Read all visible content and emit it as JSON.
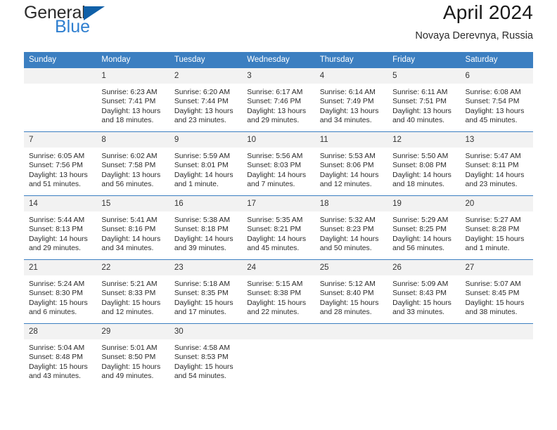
{
  "brand": {
    "line1": "General",
    "line2": "Blue",
    "logo_icon": "blue-triangle-icon"
  },
  "header": {
    "title": "April 2024",
    "subtitle": "Novaya Derevnya, Russia"
  },
  "calendar": {
    "weekday_headers": [
      "Sunday",
      "Monday",
      "Tuesday",
      "Wednesday",
      "Thursday",
      "Friday",
      "Saturday"
    ],
    "accent_color": "#3c7fc1",
    "daynum_bg": "#f2f2f2",
    "weeks": [
      [
        {
          "day": "",
          "sunrise": "",
          "sunset": "",
          "daylight_1": "",
          "daylight_2": ""
        },
        {
          "day": "1",
          "sunrise": "Sunrise: 6:23 AM",
          "sunset": "Sunset: 7:41 PM",
          "daylight_1": "Daylight: 13 hours",
          "daylight_2": "and 18 minutes."
        },
        {
          "day": "2",
          "sunrise": "Sunrise: 6:20 AM",
          "sunset": "Sunset: 7:44 PM",
          "daylight_1": "Daylight: 13 hours",
          "daylight_2": "and 23 minutes."
        },
        {
          "day": "3",
          "sunrise": "Sunrise: 6:17 AM",
          "sunset": "Sunset: 7:46 PM",
          "daylight_1": "Daylight: 13 hours",
          "daylight_2": "and 29 minutes."
        },
        {
          "day": "4",
          "sunrise": "Sunrise: 6:14 AM",
          "sunset": "Sunset: 7:49 PM",
          "daylight_1": "Daylight: 13 hours",
          "daylight_2": "and 34 minutes."
        },
        {
          "day": "5",
          "sunrise": "Sunrise: 6:11 AM",
          "sunset": "Sunset: 7:51 PM",
          "daylight_1": "Daylight: 13 hours",
          "daylight_2": "and 40 minutes."
        },
        {
          "day": "6",
          "sunrise": "Sunrise: 6:08 AM",
          "sunset": "Sunset: 7:54 PM",
          "daylight_1": "Daylight: 13 hours",
          "daylight_2": "and 45 minutes."
        }
      ],
      [
        {
          "day": "7",
          "sunrise": "Sunrise: 6:05 AM",
          "sunset": "Sunset: 7:56 PM",
          "daylight_1": "Daylight: 13 hours",
          "daylight_2": "and 51 minutes."
        },
        {
          "day": "8",
          "sunrise": "Sunrise: 6:02 AM",
          "sunset": "Sunset: 7:58 PM",
          "daylight_1": "Daylight: 13 hours",
          "daylight_2": "and 56 minutes."
        },
        {
          "day": "9",
          "sunrise": "Sunrise: 5:59 AM",
          "sunset": "Sunset: 8:01 PM",
          "daylight_1": "Daylight: 14 hours",
          "daylight_2": "and 1 minute."
        },
        {
          "day": "10",
          "sunrise": "Sunrise: 5:56 AM",
          "sunset": "Sunset: 8:03 PM",
          "daylight_1": "Daylight: 14 hours",
          "daylight_2": "and 7 minutes."
        },
        {
          "day": "11",
          "sunrise": "Sunrise: 5:53 AM",
          "sunset": "Sunset: 8:06 PM",
          "daylight_1": "Daylight: 14 hours",
          "daylight_2": "and 12 minutes."
        },
        {
          "day": "12",
          "sunrise": "Sunrise: 5:50 AM",
          "sunset": "Sunset: 8:08 PM",
          "daylight_1": "Daylight: 14 hours",
          "daylight_2": "and 18 minutes."
        },
        {
          "day": "13",
          "sunrise": "Sunrise: 5:47 AM",
          "sunset": "Sunset: 8:11 PM",
          "daylight_1": "Daylight: 14 hours",
          "daylight_2": "and 23 minutes."
        }
      ],
      [
        {
          "day": "14",
          "sunrise": "Sunrise: 5:44 AM",
          "sunset": "Sunset: 8:13 PM",
          "daylight_1": "Daylight: 14 hours",
          "daylight_2": "and 29 minutes."
        },
        {
          "day": "15",
          "sunrise": "Sunrise: 5:41 AM",
          "sunset": "Sunset: 8:16 PM",
          "daylight_1": "Daylight: 14 hours",
          "daylight_2": "and 34 minutes."
        },
        {
          "day": "16",
          "sunrise": "Sunrise: 5:38 AM",
          "sunset": "Sunset: 8:18 PM",
          "daylight_1": "Daylight: 14 hours",
          "daylight_2": "and 39 minutes."
        },
        {
          "day": "17",
          "sunrise": "Sunrise: 5:35 AM",
          "sunset": "Sunset: 8:21 PM",
          "daylight_1": "Daylight: 14 hours",
          "daylight_2": "and 45 minutes."
        },
        {
          "day": "18",
          "sunrise": "Sunrise: 5:32 AM",
          "sunset": "Sunset: 8:23 PM",
          "daylight_1": "Daylight: 14 hours",
          "daylight_2": "and 50 minutes."
        },
        {
          "day": "19",
          "sunrise": "Sunrise: 5:29 AM",
          "sunset": "Sunset: 8:25 PM",
          "daylight_1": "Daylight: 14 hours",
          "daylight_2": "and 56 minutes."
        },
        {
          "day": "20",
          "sunrise": "Sunrise: 5:27 AM",
          "sunset": "Sunset: 8:28 PM",
          "daylight_1": "Daylight: 15 hours",
          "daylight_2": "and 1 minute."
        }
      ],
      [
        {
          "day": "21",
          "sunrise": "Sunrise: 5:24 AM",
          "sunset": "Sunset: 8:30 PM",
          "daylight_1": "Daylight: 15 hours",
          "daylight_2": "and 6 minutes."
        },
        {
          "day": "22",
          "sunrise": "Sunrise: 5:21 AM",
          "sunset": "Sunset: 8:33 PM",
          "daylight_1": "Daylight: 15 hours",
          "daylight_2": "and 12 minutes."
        },
        {
          "day": "23",
          "sunrise": "Sunrise: 5:18 AM",
          "sunset": "Sunset: 8:35 PM",
          "daylight_1": "Daylight: 15 hours",
          "daylight_2": "and 17 minutes."
        },
        {
          "day": "24",
          "sunrise": "Sunrise: 5:15 AM",
          "sunset": "Sunset: 8:38 PM",
          "daylight_1": "Daylight: 15 hours",
          "daylight_2": "and 22 minutes."
        },
        {
          "day": "25",
          "sunrise": "Sunrise: 5:12 AM",
          "sunset": "Sunset: 8:40 PM",
          "daylight_1": "Daylight: 15 hours",
          "daylight_2": "and 28 minutes."
        },
        {
          "day": "26",
          "sunrise": "Sunrise: 5:09 AM",
          "sunset": "Sunset: 8:43 PM",
          "daylight_1": "Daylight: 15 hours",
          "daylight_2": "and 33 minutes."
        },
        {
          "day": "27",
          "sunrise": "Sunrise: 5:07 AM",
          "sunset": "Sunset: 8:45 PM",
          "daylight_1": "Daylight: 15 hours",
          "daylight_2": "and 38 minutes."
        }
      ],
      [
        {
          "day": "28",
          "sunrise": "Sunrise: 5:04 AM",
          "sunset": "Sunset: 8:48 PM",
          "daylight_1": "Daylight: 15 hours",
          "daylight_2": "and 43 minutes."
        },
        {
          "day": "29",
          "sunrise": "Sunrise: 5:01 AM",
          "sunset": "Sunset: 8:50 PM",
          "daylight_1": "Daylight: 15 hours",
          "daylight_2": "and 49 minutes."
        },
        {
          "day": "30",
          "sunrise": "Sunrise: 4:58 AM",
          "sunset": "Sunset: 8:53 PM",
          "daylight_1": "Daylight: 15 hours",
          "daylight_2": "and 54 minutes."
        },
        {
          "day": "",
          "sunrise": "",
          "sunset": "",
          "daylight_1": "",
          "daylight_2": ""
        },
        {
          "day": "",
          "sunrise": "",
          "sunset": "",
          "daylight_1": "",
          "daylight_2": ""
        },
        {
          "day": "",
          "sunrise": "",
          "sunset": "",
          "daylight_1": "",
          "daylight_2": ""
        },
        {
          "day": "",
          "sunrise": "",
          "sunset": "",
          "daylight_1": "",
          "daylight_2": ""
        }
      ]
    ]
  }
}
